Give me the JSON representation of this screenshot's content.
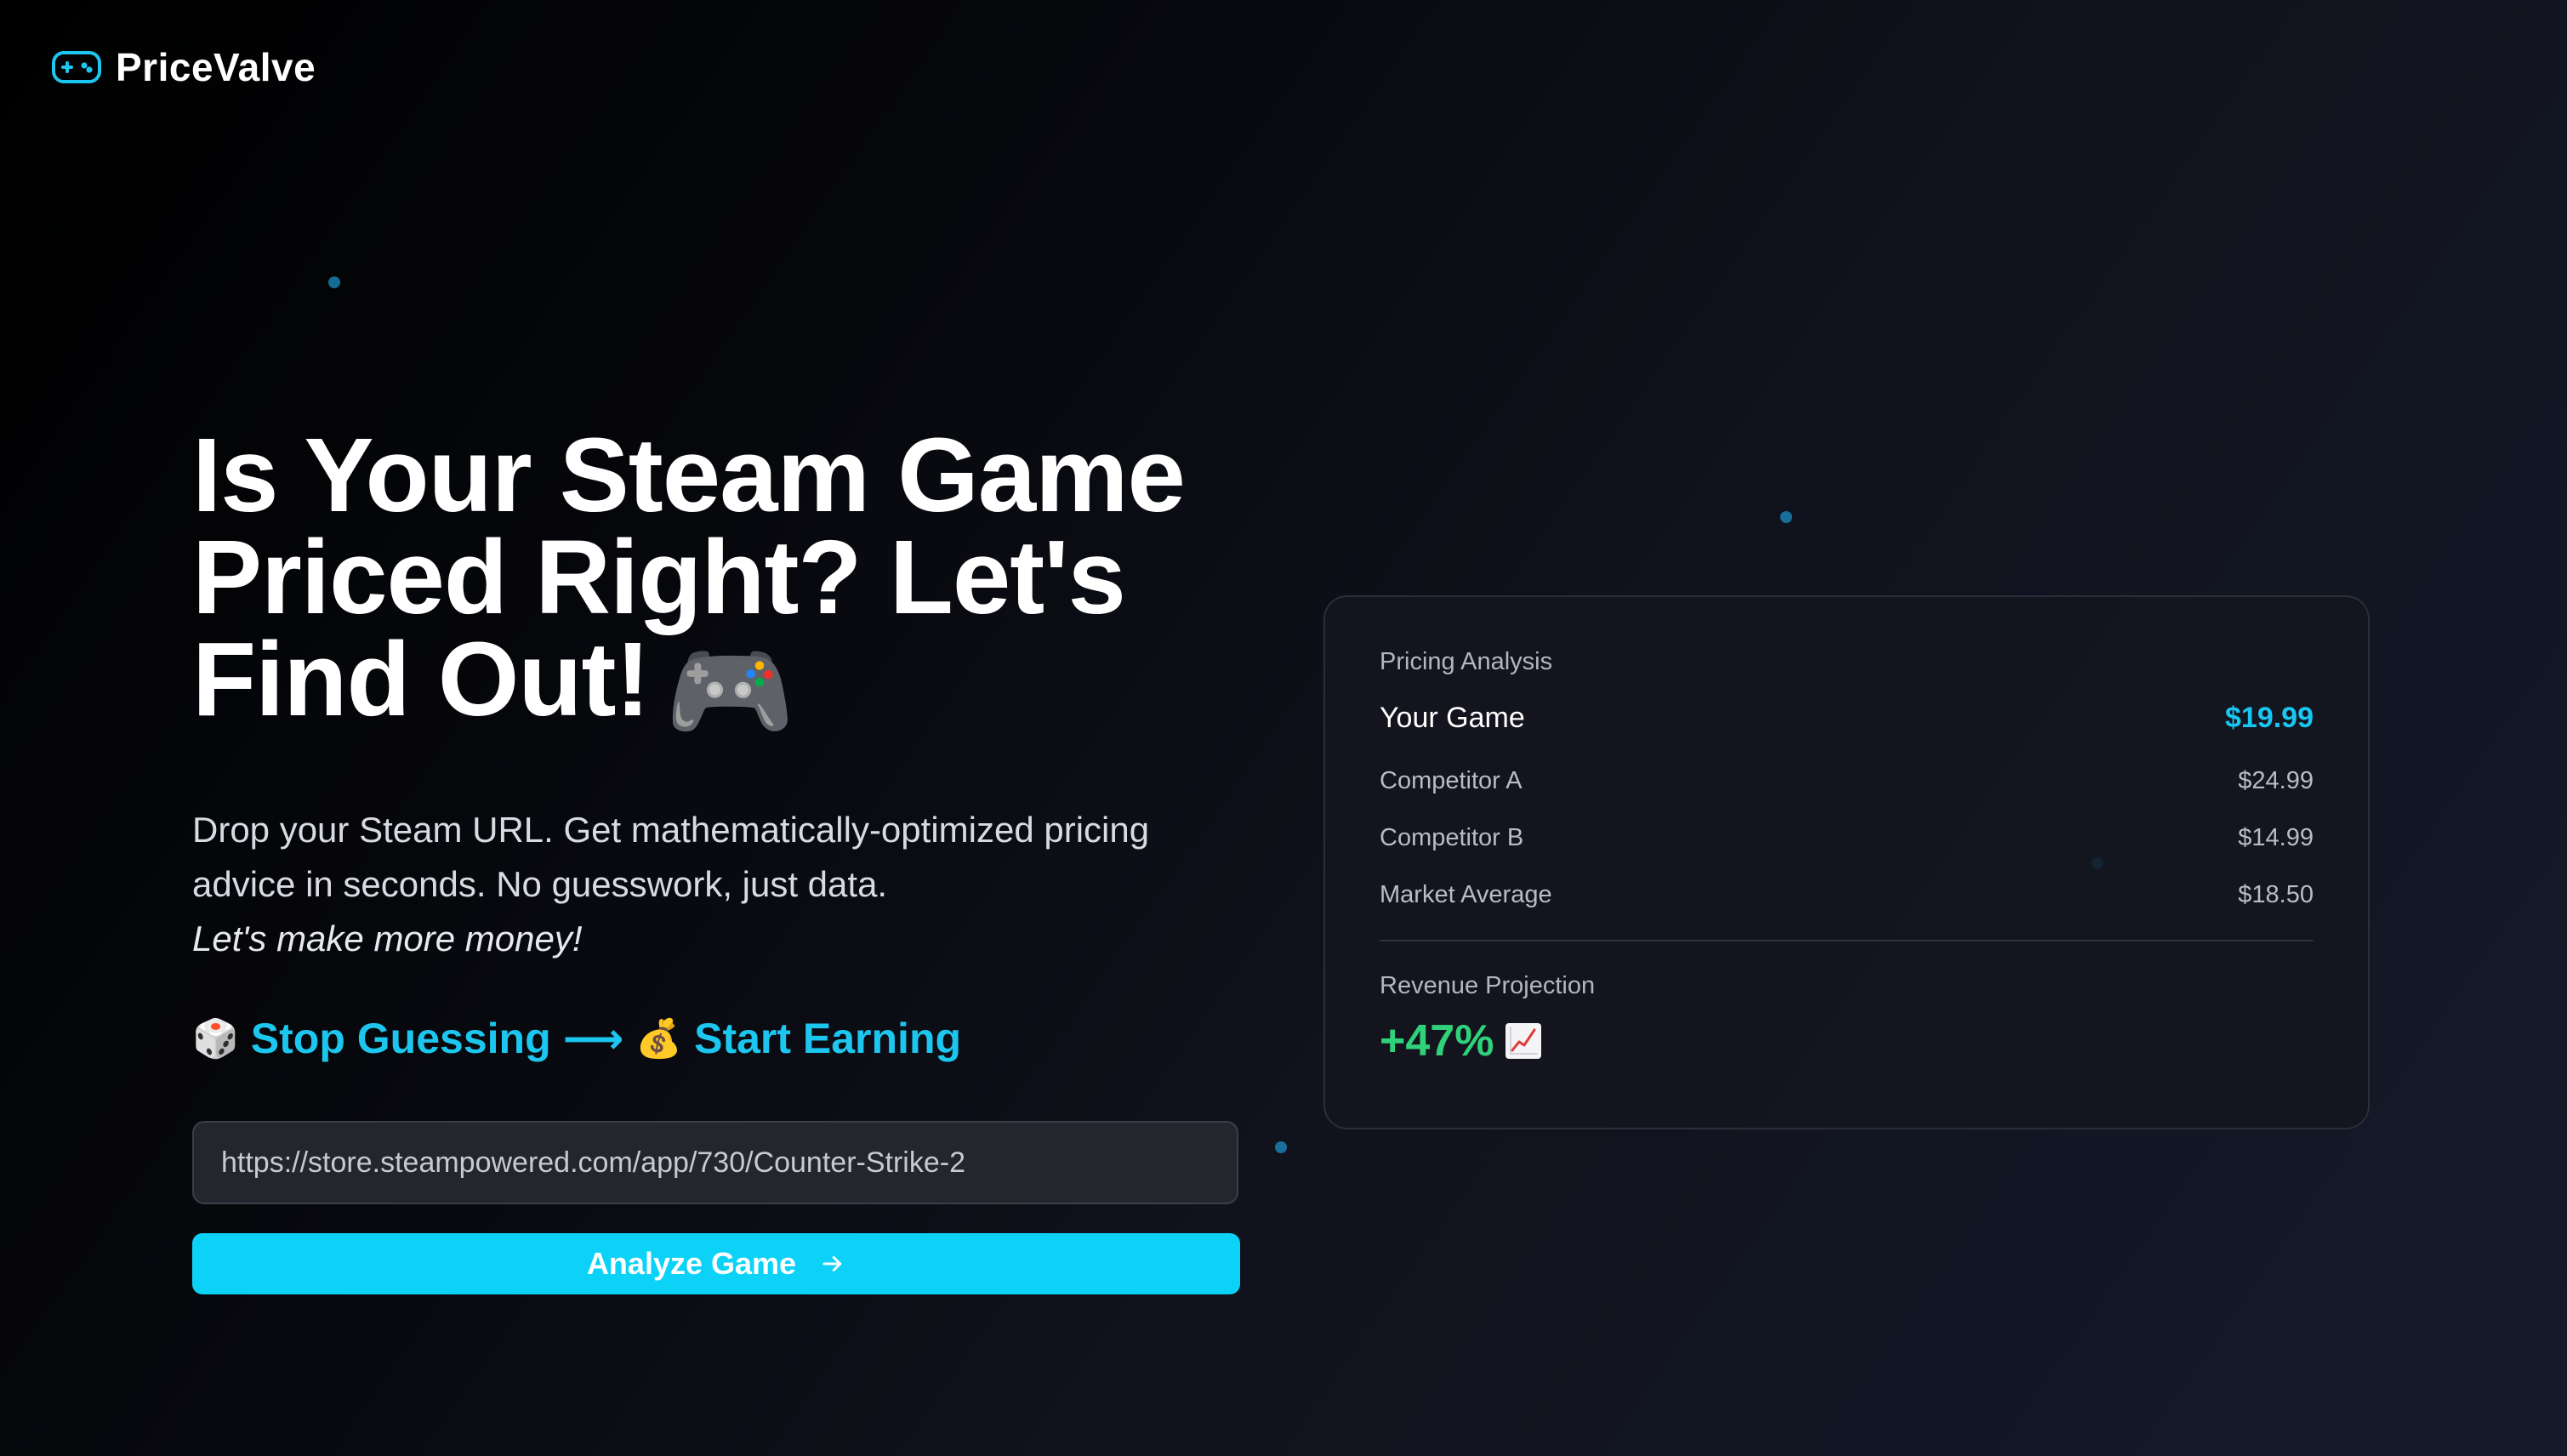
{
  "brand": {
    "name": "PriceValve",
    "logo_icon": "gamepad-icon",
    "accent": "#1dc6ee"
  },
  "hero": {
    "title": "Is Your Steam Game Priced Right? Let's Find Out!",
    "title_emoji": "🎮",
    "subtitle": "Drop your Steam URL. Get mathematically-optimized pricing advice in seconds. No guesswork, just data.",
    "subtitle_italic": "Let's make more money!",
    "tagline": {
      "emoji_left": "🎲",
      "left": "Stop Guessing",
      "arrow": "⟶",
      "emoji_right": "💰",
      "right": "Start Earning"
    }
  },
  "form": {
    "url_value": "https://store.steampowered.com/app/730/Counter-Strike-2",
    "url_placeholder": "https://store.steampowered.com/app/730/Counter-Strike-2",
    "analyze_label": "Analyze Game",
    "button_color": "#0bd2f6"
  },
  "card": {
    "label": "Pricing Analysis",
    "your_game": {
      "name": "Your Game",
      "price": "$19.99"
    },
    "competitors": [
      {
        "name": "Competitor A",
        "price": "$24.99"
      },
      {
        "name": "Competitor B",
        "price": "$14.99"
      },
      {
        "name": "Market Average",
        "price": "$18.50"
      }
    ],
    "projection_label": "Revenue Projection",
    "projection_value": "+47%",
    "projection_icon": "chart-increasing-icon",
    "projection_color": "#2fd27a"
  }
}
